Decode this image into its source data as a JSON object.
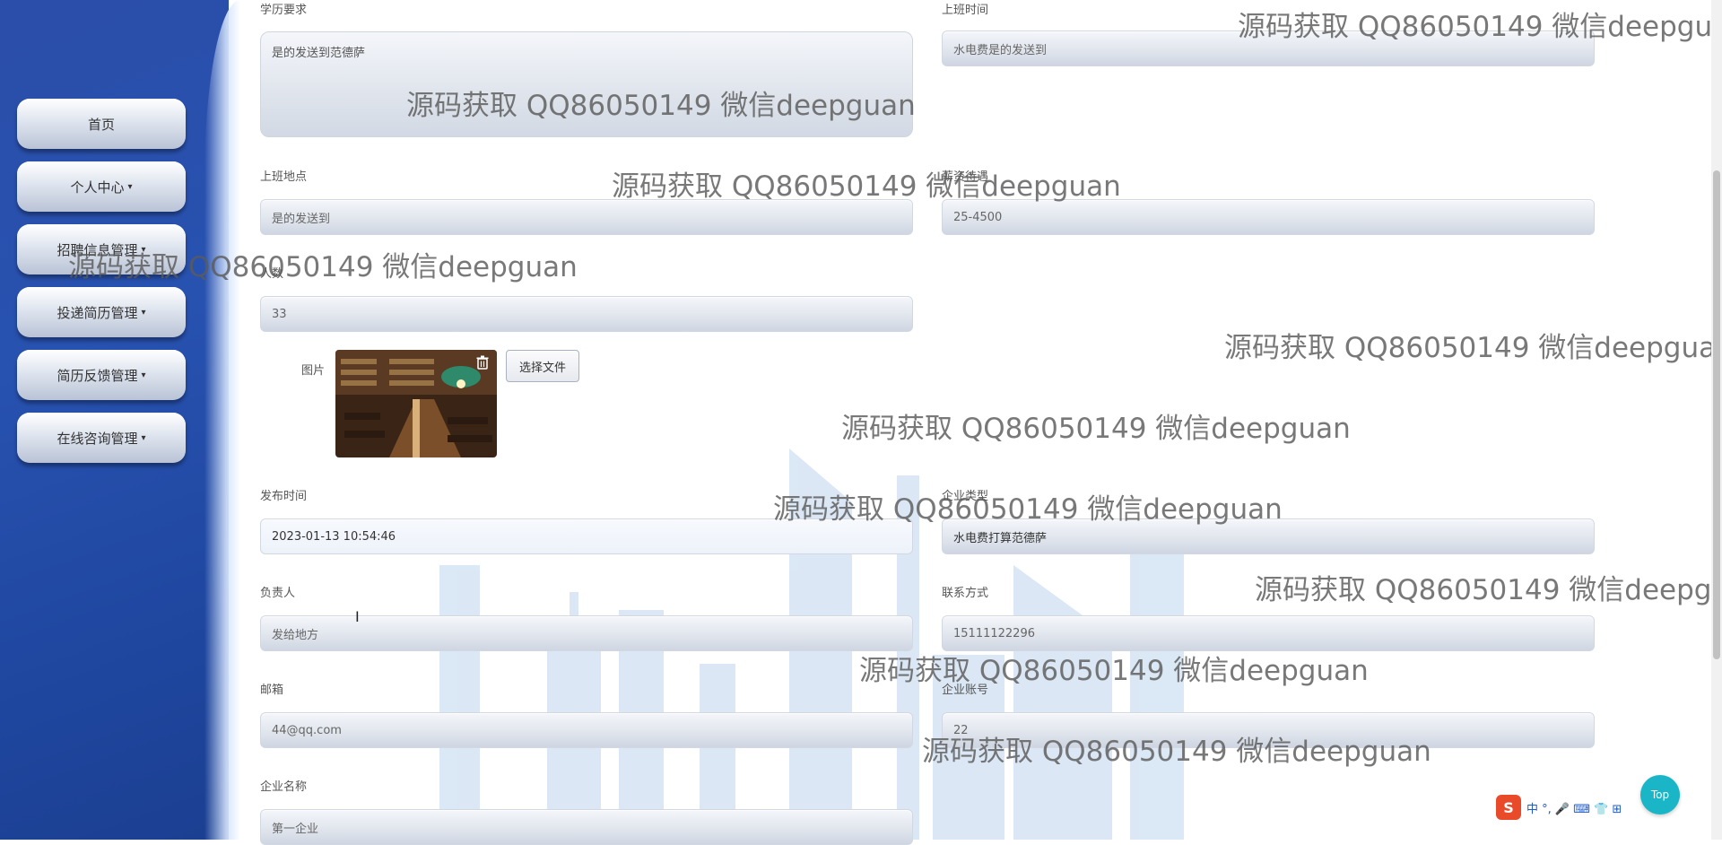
{
  "sidebar": {
    "items": [
      {
        "label": "首页",
        "has_caret": false
      },
      {
        "label": "个人中心",
        "has_caret": true
      },
      {
        "label": "招聘信息管理",
        "has_caret": true
      },
      {
        "label": "投递简历管理",
        "has_caret": true
      },
      {
        "label": "简历反馈管理",
        "has_caret": true
      },
      {
        "label": "在线咨询管理",
        "has_caret": true
      }
    ],
    "caret": "▾"
  },
  "form": {
    "education": {
      "label": "学历要求",
      "value": "是的发送到范德萨"
    },
    "work_time": {
      "label": "上班时间",
      "value": "水电费是的发送到"
    },
    "work_place": {
      "label": "上班地点",
      "value": "是的发送到"
    },
    "salary": {
      "label": "薪资待遇",
      "value": "25-4500"
    },
    "headcount": {
      "label": "人数",
      "value": "33"
    },
    "image": {
      "label": "图片",
      "choose_file": "选择文件"
    },
    "publish_time": {
      "label": "发布时间",
      "value": "2023-01-13 10:54:46"
    },
    "company_type": {
      "label": "企业类型",
      "value": "水电费打算范德萨"
    },
    "person_in_charge": {
      "label": "负责人",
      "value": "发给地方"
    },
    "contact": {
      "label": "联系方式",
      "value": "15111122296"
    },
    "email": {
      "label": "邮箱",
      "value": "44@qq.com"
    },
    "company_account": {
      "label": "企业账号",
      "value": "22"
    },
    "company_name": {
      "label": "企业名称",
      "value": "第一企业"
    }
  },
  "watermark": "源码获取 QQ86050149 微信deepguan",
  "top_button": "Top",
  "ime": {
    "logo": "S",
    "text": "中 °, 🎤 ⌨ 👕 ⊞"
  },
  "colors": {
    "sidebar": "#2852b0",
    "top_button": "#1ab6c8",
    "ime_logo": "#e84a2a"
  }
}
